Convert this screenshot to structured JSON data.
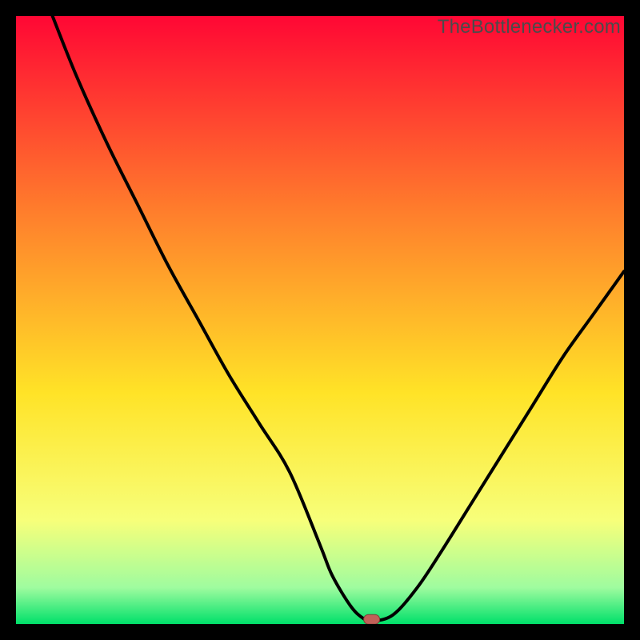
{
  "watermark": "TheBottlenecker.com",
  "colors": {
    "gradient_top": "#ff0734",
    "gradient_upper_mid": "#ff7d2c",
    "gradient_mid": "#ffe327",
    "gradient_lower_mid": "#f7ff7a",
    "gradient_near_bottom": "#9ffc9f",
    "gradient_bottom": "#00e06a",
    "background": "#000000",
    "curve": "#000000",
    "marker_fill": "#c06058",
    "marker_stroke": "#7a3a34"
  },
  "chart_data": {
    "type": "line",
    "title": "",
    "xlabel": "",
    "ylabel": "",
    "xlim": [
      0,
      100
    ],
    "ylim": [
      0,
      100
    ],
    "series": [
      {
        "name": "bottleneck-curve",
        "x": [
          6,
          10,
          15,
          20,
          25,
          30,
          35,
          40,
          45,
          50,
          52,
          55,
          57,
          58.5,
          62,
          66,
          70,
          75,
          80,
          85,
          90,
          95,
          100
        ],
        "y": [
          100,
          90,
          79,
          69,
          59,
          50,
          41,
          33,
          25,
          13,
          8,
          3,
          1,
          0.5,
          1.5,
          6,
          12,
          20,
          28,
          36,
          44,
          51,
          58
        ]
      }
    ],
    "marker": {
      "x": 58.5,
      "y": 0.5,
      "label": "optimal-point"
    }
  }
}
